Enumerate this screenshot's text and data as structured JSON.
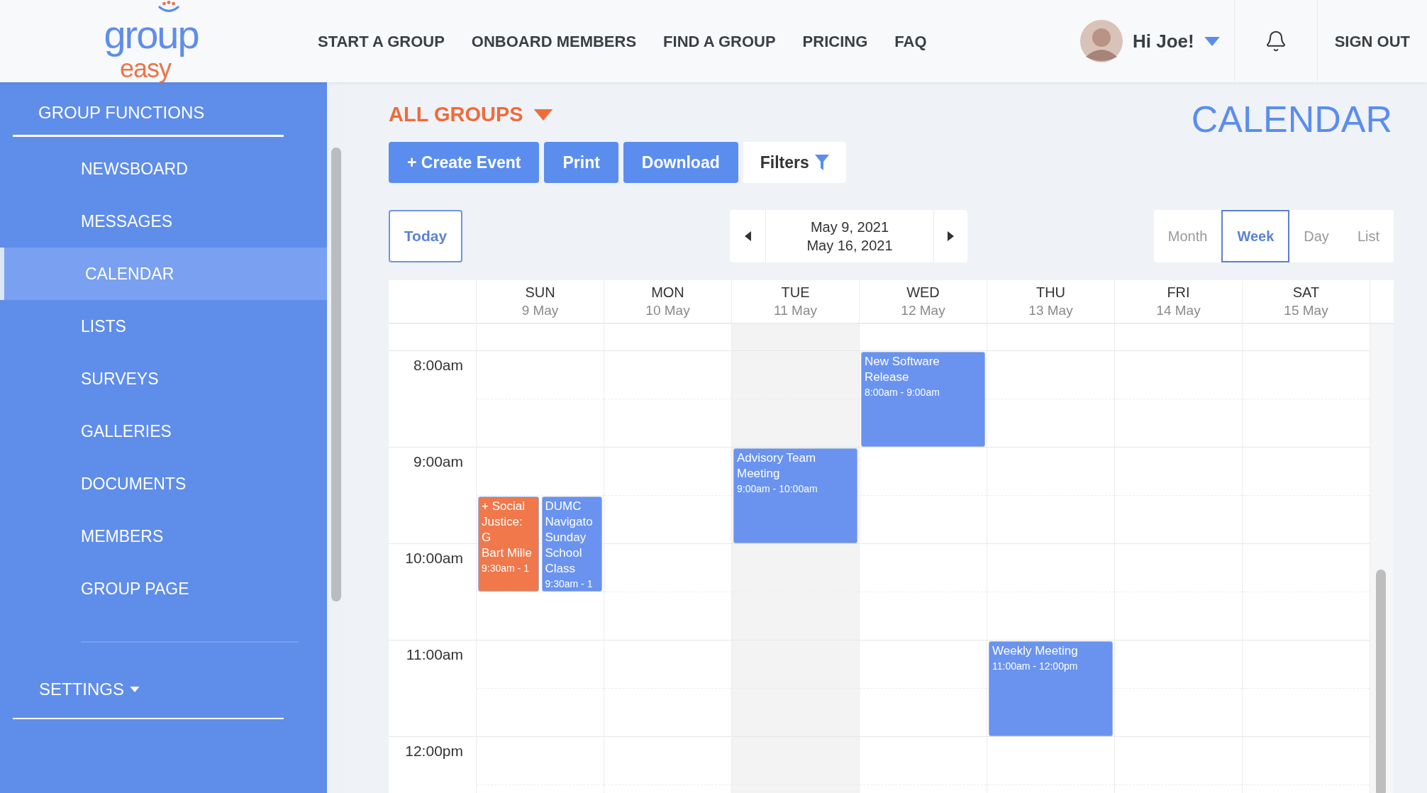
{
  "logo": {
    "top": "group",
    "bottom": "easy"
  },
  "nav": [
    "START A GROUP",
    "ONBOARD MEMBERS",
    "FIND A GROUP",
    "PRICING",
    "FAQ"
  ],
  "user": {
    "greeting": "Hi Joe!"
  },
  "sign_out": "SIGN OUT",
  "sidebar": {
    "title": "GROUP FUNCTIONS",
    "items": [
      {
        "label": "NEWSBOARD",
        "selected": false
      },
      {
        "label": "MESSAGES",
        "selected": false
      },
      {
        "label": "CALENDAR",
        "selected": true
      },
      {
        "label": "LISTS",
        "selected": false
      },
      {
        "label": "SURVEYS",
        "selected": false
      },
      {
        "label": "GALLERIES",
        "selected": false
      },
      {
        "label": "DOCUMENTS",
        "selected": false
      },
      {
        "label": "MEMBERS",
        "selected": false
      },
      {
        "label": "GROUP PAGE",
        "selected": false
      }
    ],
    "settings": "SETTINGS"
  },
  "group_selector": "ALL GROUPS",
  "page_title": "CALENDAR",
  "actions": [
    {
      "label": "+ Create Event",
      "kind": "primary"
    },
    {
      "label": "Print",
      "kind": "primary"
    },
    {
      "label": "Download",
      "kind": "primary"
    },
    {
      "label": "Filters",
      "kind": "filter"
    }
  ],
  "today_button": "Today",
  "date_range": {
    "start": "May 9, 2021",
    "end": "May 16, 2021"
  },
  "views": [
    {
      "label": "Month",
      "selected": false
    },
    {
      "label": "Week",
      "selected": true
    },
    {
      "label": "Day",
      "selected": false
    },
    {
      "label": "List",
      "selected": false
    }
  ],
  "hours": [
    "8:00am",
    "9:00am",
    "10:00am",
    "11:00am",
    "12:00pm"
  ],
  "days": [
    {
      "name": "SUN",
      "date": "9 May",
      "today": false,
      "events": [
        {
          "title": "+ Social Justice: G",
          "subtitle": "Bart Mille",
          "time": "9:30am - 1",
          "color": "#f0784a"
        },
        {
          "title": "DUMC Navigato Sunday School Class",
          "time": "9:30am - 1",
          "color": "#6a93ef"
        }
      ]
    },
    {
      "name": "MON",
      "date": "10 May",
      "today": false
    },
    {
      "name": "TUE",
      "date": "11 May",
      "today": true,
      "events": [
        {
          "title": "Advisory Team Meeting",
          "time": "9:00am - 10:00am",
          "color": "#6a93ef"
        }
      ]
    },
    {
      "name": "WED",
      "date": "12 May",
      "today": false,
      "events": [
        {
          "title": "New Software Release",
          "time": "8:00am - 9:00am",
          "color": "#6a93ef"
        }
      ]
    },
    {
      "name": "THU",
      "date": "13 May",
      "today": false,
      "events": [
        {
          "title": "Weekly Meeting",
          "time": "11:00am - 12:00pm",
          "color": "#6a93ef"
        }
      ]
    },
    {
      "name": "FRI",
      "date": "14 May",
      "today": false
    },
    {
      "name": "SAT",
      "date": "15 May",
      "today": false
    }
  ]
}
